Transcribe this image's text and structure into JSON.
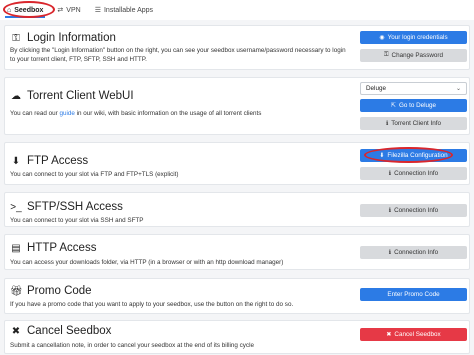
{
  "tabs": [
    {
      "label": "Seedbox",
      "icon": "home-icon"
    },
    {
      "label": "VPN",
      "icon": "shuffle-icon"
    },
    {
      "label": "Installable Apps",
      "icon": "list-icon"
    }
  ],
  "panels": {
    "login": {
      "title": "Login Information",
      "desc": "By clicking the \"Login Information\" button on the right, you can see your seedbox username/password necessary to login to your torrent client, FTP, SFTP, SSH and HTTP.",
      "btn_primary": "Your login credentials",
      "btn_secondary": "Change Password"
    },
    "torrent": {
      "title": "Torrent Client WebUI",
      "desc_before": "You can read our ",
      "desc_link": "guide",
      "desc_after": " in our wiki, with basic information on the usage of all torrent clients",
      "select_value": "Deluge",
      "btn_primary": "Go to Deluge",
      "btn_secondary": "Torrent Client Info"
    },
    "ftp": {
      "title": "FTP Access",
      "desc": "You can connect to your slot via FTP and FTP+TLS (explicit)",
      "btn_primary": "Filezilla Configuration",
      "btn_secondary": "Connection Info"
    },
    "sftp": {
      "title": "SFTP/SSH Access",
      "desc": "You can connect to your slot via SSH and SFTP",
      "btn_secondary": "Connection Info"
    },
    "http": {
      "title": "HTTP Access",
      "desc": "You can access your downloads folder, via HTTP (in a browser or with an http download manager)",
      "btn_secondary": "Connection Info"
    },
    "promo": {
      "title": "Promo Code",
      "desc": "If you have a promo code that you want to apply to your seedbox, use the button on the right to do so.",
      "btn_primary": "Enter Promo Code"
    },
    "cancel": {
      "title": "Cancel Seedbox",
      "desc": "Submit a cancellation note, in order to cancel your seedbox at the end of its billing cycle",
      "btn_danger": "Cancel Seedbox"
    }
  },
  "colors": {
    "primary": "#2c7be5",
    "grey_button": "#d8dadd",
    "danger": "#e63946",
    "annotation_ring": "#d9262c"
  }
}
